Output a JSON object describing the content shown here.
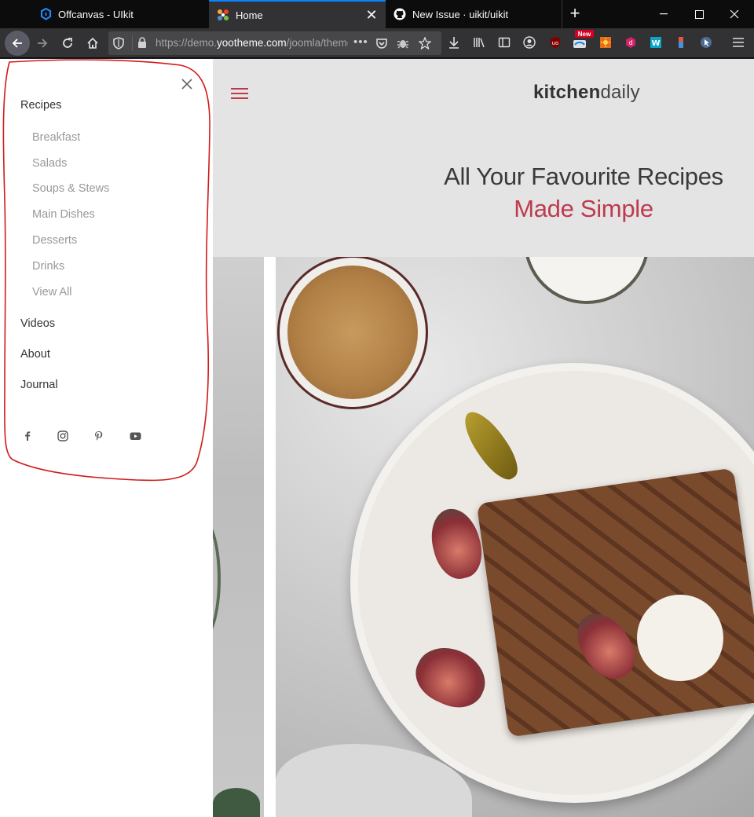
{
  "browser": {
    "tabs": [
      {
        "title": "Offcanvas - UIkit",
        "favicon": "uikit-icon",
        "active": false
      },
      {
        "title": "Home",
        "favicon": "joomla-icon",
        "active": true
      },
      {
        "title": "New Issue · uikit/uikit",
        "favicon": "github-icon",
        "active": false
      }
    ],
    "new_tab_label": "+",
    "url_host_prefix": "https://demo.",
    "url_host": "yootheme.com",
    "url_path": "/joomla/themes/kitchendaily",
    "more_label": "•••",
    "badge_new": "New"
  },
  "site": {
    "brand_bold": "kitchen",
    "brand_light": "daily",
    "hero_line1": "All Your Favourite Recipes",
    "hero_line2": "Made Simple",
    "accent_color": "#be3a4f"
  },
  "offcanvas": {
    "menu": [
      {
        "label": "Recipes"
      },
      {
        "label": "Videos"
      },
      {
        "label": "About"
      },
      {
        "label": "Journal"
      }
    ],
    "recipes_sub": [
      {
        "label": "Breakfast"
      },
      {
        "label": "Salads"
      },
      {
        "label": "Soups & Stews"
      },
      {
        "label": "Main Dishes"
      },
      {
        "label": "Desserts"
      },
      {
        "label": "Drinks"
      },
      {
        "label": "View All"
      }
    ],
    "social": [
      "facebook-icon",
      "instagram-icon",
      "pinterest-icon",
      "youtube-icon"
    ]
  }
}
